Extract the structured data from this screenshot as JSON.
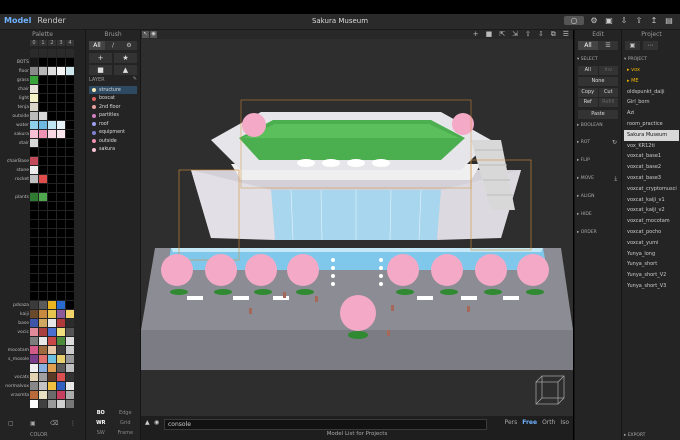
{
  "app": {
    "menu": [
      "Model",
      "Render"
    ],
    "title": "Sakura Museum",
    "top_icons": [
      "toggle-icon",
      "gear-icon",
      "save-icon",
      "import-icon",
      "export-icon",
      "upload-icon",
      "image-icon"
    ]
  },
  "palette": {
    "title": "Palette",
    "columns": [
      "0",
      "1",
      "2",
      "3",
      "4"
    ],
    "rows": [
      {
        "label": "",
        "colors": [
          "#2b2b2b",
          "#2b2b2b",
          "#2b2b2b",
          "#2b2b2b",
          "#2b2b2b"
        ]
      },
      {
        "label": "BOTS",
        "colors": [
          "#181818",
          "#000",
          "#000",
          "#000",
          "#000"
        ]
      },
      {
        "label": "floor",
        "colors": [
          "#8a8a8a",
          "#b7b7b7",
          "#dcdcdc",
          "#f4f4f4",
          "#cde7ec"
        ]
      },
      {
        "label": "grass",
        "colors": [
          "#38a43a",
          "#000",
          "#000",
          "#000",
          "#000"
        ]
      },
      {
        "label": "chair",
        "colors": [
          "#e8e3da",
          "#000",
          "#000",
          "#000",
          "#000"
        ]
      },
      {
        "label": "light",
        "colors": [
          "#f5f2c8",
          "#000",
          "#000",
          "#000",
          "#000"
        ]
      },
      {
        "label": "tenja",
        "colors": [
          "#d9d4c8",
          "#000",
          "#000",
          "#000",
          "#000"
        ]
      },
      {
        "label": "outside",
        "colors": [
          "#bbbbbb",
          "#d8d8d8",
          "#000",
          "#000",
          "#000"
        ]
      },
      {
        "label": "water",
        "colors": [
          "#8fd0ea",
          "#6cb8df",
          "#bfe4f2",
          "#e6f4f9",
          "#000"
        ]
      },
      {
        "label": "sakura",
        "colors": [
          "#f6bfd3",
          "#ef93b4",
          "#f9d6e3",
          "#fbe6ee",
          "#000"
        ]
      },
      {
        "label": "stair",
        "colors": [
          "#d8d8d8",
          "#000",
          "#000",
          "#000",
          "#000"
        ]
      },
      {
        "label": "",
        "colors": [
          "#000",
          "#000",
          "#000",
          "#000",
          "#000"
        ]
      },
      {
        "label": "chairBase",
        "colors": [
          "#c24a5a",
          "#000",
          "#000",
          "#000",
          "#000"
        ]
      },
      {
        "label": "stone",
        "colors": [
          "#eeeeee",
          "#000",
          "#000",
          "#000",
          "#000"
        ]
      },
      {
        "label": "rocket",
        "colors": [
          "#c0c0c0",
          "#e04c4c",
          "#000",
          "#000",
          "#000"
        ]
      },
      {
        "label": "",
        "colors": [
          "#000",
          "#000",
          "#000",
          "#000",
          "#000"
        ]
      },
      {
        "label": "plants",
        "colors": [
          "#2f7a31",
          "#4fa74f",
          "#000",
          "#000",
          "#000"
        ]
      },
      {
        "label": "",
        "colors": [
          "#000",
          "#000",
          "#000",
          "#000",
          "#000"
        ]
      },
      {
        "label": "",
        "colors": [
          "#000",
          "#000",
          "#000",
          "#000",
          "#000"
        ]
      },
      {
        "label": "",
        "colors": [
          "#000",
          "#000",
          "#000",
          "#000",
          "#000"
        ]
      },
      {
        "label": "",
        "colors": [
          "#000",
          "#000",
          "#000",
          "#000",
          "#000"
        ]
      },
      {
        "label": "",
        "colors": [
          "#000",
          "#000",
          "#000",
          "#000",
          "#000"
        ]
      },
      {
        "label": "",
        "colors": [
          "#000",
          "#000",
          "#000",
          "#000",
          "#000"
        ]
      },
      {
        "label": "",
        "colors": [
          "#000",
          "#000",
          "#000",
          "#000",
          "#000"
        ]
      },
      {
        "label": "",
        "colors": [
          "#000",
          "#000",
          "#000",
          "#000",
          "#000"
        ]
      },
      {
        "label": "",
        "colors": [
          "#000",
          "#000",
          "#000",
          "#000",
          "#000"
        ]
      },
      {
        "label": "",
        "colors": [
          "#000",
          "#000",
          "#000",
          "#000",
          "#000"
        ]
      },
      {
        "label": "",
        "colors": [
          "#000",
          "#000",
          "#000",
          "#000",
          "#000"
        ]
      },
      {
        "label": "pdsaza",
        "colors": [
          "#3a3a3a",
          "#5a5a5a",
          "#e8b520",
          "#2a6acf",
          "#000"
        ]
      },
      {
        "label": "kaiji",
        "colors": [
          "#6a4a2a",
          "#c78a3e",
          "#e7c44d",
          "#8a5a9a",
          "#f1d36a"
        ]
      },
      {
        "label": "base",
        "colors": [
          "#3f56a8",
          "#d0a860",
          "#e6e6e6",
          "#b03a3a",
          "#2c2c2c"
        ]
      },
      {
        "label": "vocic",
        "colors": [
          "#e08a9a",
          "#a93f3f",
          "#4a6fd0",
          "#f0e080",
          "#555"
        ]
      },
      {
        "label": "",
        "colors": [
          "#7d7d7d",
          "#e8e8e8",
          "#c84848",
          "#4c8a3e",
          "#ddd"
        ]
      },
      {
        "label": "mocotam",
        "colors": [
          "#d45a8a",
          "#9e6a3e",
          "#e6c6a6",
          "#3e3e3e",
          "#ccc"
        ]
      },
      {
        "label": "s_mosole",
        "colors": [
          "#7a3e8a",
          "#e07070",
          "#6ec0e0",
          "#e8d070",
          "#999"
        ]
      },
      {
        "label": "",
        "colors": [
          "#f0f0f0",
          "#8ab0e0",
          "#e0a050",
          "#5a5a5a",
          "#c0c0c0"
        ]
      },
      {
        "label": "vocats",
        "colors": [
          "#e4d4b4",
          "#a0a0a0",
          "#5c3a28",
          "#d85050",
          "#333"
        ]
      },
      {
        "label": "normalvox",
        "colors": [
          "#888",
          "#c4c4c4",
          "#f0c040",
          "#3060c0",
          "#e8e8e8"
        ]
      },
      {
        "label": "vrasmta",
        "colors": [
          "#b86a3a",
          "#e8e0c0",
          "#6a6a6a",
          "#c83e5e",
          "#aaa"
        ]
      },
      {
        "label": "",
        "colors": [
          "#ffffff",
          "#404040",
          "#9a9a9a",
          "#d0d0d0",
          "#777"
        ]
      }
    ],
    "footer_icons": [
      "folder-icon",
      "save-icon",
      "trash-icon",
      "more-icon"
    ],
    "color_label": "COLOR"
  },
  "brush": {
    "title": "Brush",
    "modes": [
      "All",
      "∕",
      "⚙"
    ],
    "tools": [
      "+",
      "★",
      "■",
      "▲"
    ],
    "layer_label": "LAYER",
    "layers": [
      {
        "name": "structure",
        "color": "#f5e9b8"
      },
      {
        "name": "boscat",
        "color": "#e06060"
      },
      {
        "name": "2nd floor",
        "color": "#e8a0a0"
      },
      {
        "name": "partitles",
        "color": "#d080c0"
      },
      {
        "name": "roof",
        "color": "#a0a0f0"
      },
      {
        "name": "equipment",
        "color": "#8080d0"
      },
      {
        "name": "outside",
        "color": "#f090b0"
      },
      {
        "name": "sakura",
        "color": "#f5c0d4"
      }
    ],
    "bottom": [
      {
        "label": "BO",
        "on": true
      },
      {
        "label": "Edge",
        "on": false
      },
      {
        "label": "WR",
        "on": true
      },
      {
        "label": "Grid",
        "on": false
      },
      {
        "label": "SW",
        "on": false
      },
      {
        "label": "Frame",
        "on": false
      }
    ]
  },
  "viewport": {
    "tool_right": [
      "+",
      "■",
      "⇱",
      "⇲",
      "⇧",
      "⇩",
      "⧉",
      "☰"
    ],
    "console_text": "console",
    "views": [
      "Pers",
      "Free",
      "Orth",
      "Iso"
    ],
    "active_view": "Free",
    "status_text": "Model List for Projects"
  },
  "edit": {
    "title": "Edit",
    "modes": [
      "All",
      "☰"
    ],
    "select_label": "SELECT",
    "select_buttons": [
      "All",
      "Inv",
      "None",
      "",
      "Copy",
      "Cut",
      "Ref",
      "Refill",
      "Paste",
      ""
    ],
    "boolean_label": "BOOLEAN",
    "ops": [
      {
        "label": "ROT",
        "icon": "↻"
      },
      {
        "label": "FLIP",
        "icon": ""
      },
      {
        "label": "MOVE",
        "icon": "⤓"
      },
      {
        "label": "ALIGN",
        "icon": ""
      },
      {
        "label": "HIDE",
        "icon": ""
      },
      {
        "label": "ORDER",
        "icon": ""
      }
    ]
  },
  "project": {
    "title": "Project",
    "buttons": [
      "▣",
      "⋯"
    ],
    "section": "PROJECT",
    "items": [
      {
        "name": "vox",
        "type": "folder"
      },
      {
        "name": "ME",
        "type": "folder"
      },
      {
        "name": "oldspunkt_daiji",
        "type": "file"
      },
      {
        "name": "Girl_born",
        "type": "file"
      },
      {
        "name": "Azi",
        "type": "file"
      },
      {
        "name": "room_practice",
        "type": "file"
      },
      {
        "name": "Sakura Museum",
        "type": "file",
        "selected": true
      },
      {
        "name": "vox_KR12ti",
        "type": "file"
      },
      {
        "name": "voxcat_base1",
        "type": "file"
      },
      {
        "name": "voxcat_base2",
        "type": "file"
      },
      {
        "name": "voxcat_base3",
        "type": "file"
      },
      {
        "name": "voxcat_cryptomusci",
        "type": "file"
      },
      {
        "name": "voxcat_kaiji_v1",
        "type": "file"
      },
      {
        "name": "voxcat_kaiji_v2",
        "type": "file"
      },
      {
        "name": "voxcat_mocotam",
        "type": "file"
      },
      {
        "name": "voxcat_pocho",
        "type": "file"
      },
      {
        "name": "voxcat_yumi",
        "type": "file"
      },
      {
        "name": "Yunya_long",
        "type": "file"
      },
      {
        "name": "Yunya_short",
        "type": "file"
      },
      {
        "name": "Yunya_short_V2",
        "type": "file"
      },
      {
        "name": "Yunya_short_V3",
        "type": "file"
      }
    ],
    "export_label": "EXPORT"
  }
}
